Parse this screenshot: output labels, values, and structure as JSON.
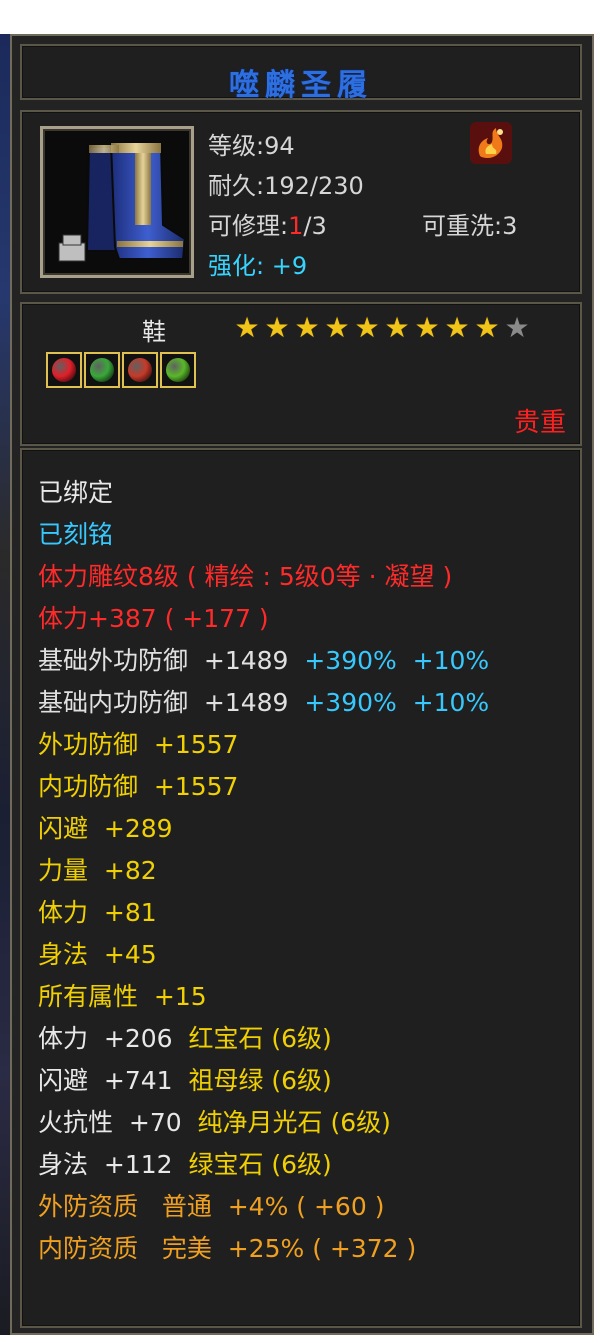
{
  "item": {
    "name": "噬麟圣履",
    "level_label": "等级",
    "level_value": ":94",
    "durability_label": "耐久",
    "durability_value": ":192/230",
    "repair_label": "可修理:",
    "repair_current": "1",
    "repair_max": "/3",
    "reforge_label": "可重洗:",
    "reforge_value": "3",
    "enhance_label": "强化:",
    "enhance_value": "+9",
    "element_icon": "fire-element-icon",
    "slot": "鞋",
    "stars_filled": 9,
    "stars_total": 10,
    "rarity": "贵重",
    "gems": [
      {
        "name": "red-gem-icon",
        "color": "#e0202a"
      },
      {
        "name": "green-leaf-gem-icon",
        "color": "#3aa83a"
      },
      {
        "name": "red-flame-gem-icon",
        "color": "#c63a2a"
      },
      {
        "name": "green-gem-icon",
        "color": "#5ab82a"
      }
    ]
  },
  "stats": [
    [
      {
        "t": "已绑定",
        "c": "#e8e8e8"
      }
    ],
    [
      {
        "t": "已刻铭",
        "c": "#36c8ff"
      }
    ],
    [
      {
        "t": "体力雕纹8级 ( 精绘 : 5级0等 · 凝望 )",
        "c": "#ff2a2a"
      }
    ],
    [
      {
        "t": "体力+387 ( +177 )",
        "c": "#ff2a2a"
      }
    ],
    [
      {
        "t": "基础外功防御  +1489  ",
        "c": "#e0e0e0"
      },
      {
        "t": "+390%  +10%",
        "c": "#36c8ff"
      }
    ],
    [
      {
        "t": "基础内功防御  +1489  ",
        "c": "#e0e0e0"
      },
      {
        "t": "+390%  +10%",
        "c": "#36c8ff"
      }
    ],
    [
      {
        "t": "外功防御  +1557",
        "c": "#f0d000"
      }
    ],
    [
      {
        "t": "内功防御  +1557",
        "c": "#f0d000"
      }
    ],
    [
      {
        "t": "闪避  +289",
        "c": "#f0d000"
      }
    ],
    [
      {
        "t": "力量  +82",
        "c": "#f0d000"
      }
    ],
    [
      {
        "t": "体力  +81",
        "c": "#f0d000"
      }
    ],
    [
      {
        "t": "身法  +45",
        "c": "#f0d000"
      }
    ],
    [
      {
        "t": "所有属性  +15",
        "c": "#f0d000"
      }
    ],
    [
      {
        "t": "体力  +206  ",
        "c": "#e8e8e8"
      },
      {
        "t": "红宝石 (6级)",
        "c": "#f0d000"
      }
    ],
    [
      {
        "t": "闪避  +741  ",
        "c": "#e8e8e8"
      },
      {
        "t": "祖母绿 (6级)",
        "c": "#f0d000"
      }
    ],
    [
      {
        "t": "火抗性  +70  ",
        "c": "#e8e8e8"
      },
      {
        "t": "纯净月光石 (6级)",
        "c": "#f0d000"
      }
    ],
    [
      {
        "t": "身法  +112  ",
        "c": "#e8e8e8"
      },
      {
        "t": "绿宝石 (6级)",
        "c": "#f0d000"
      }
    ],
    [
      {
        "t": "外防资质   普通  +4% ( +60 )",
        "c": "#f0a020"
      }
    ],
    [
      {
        "t": "内防资质   完美  +25% ( +372 )",
        "c": "#f0a020"
      }
    ]
  ]
}
